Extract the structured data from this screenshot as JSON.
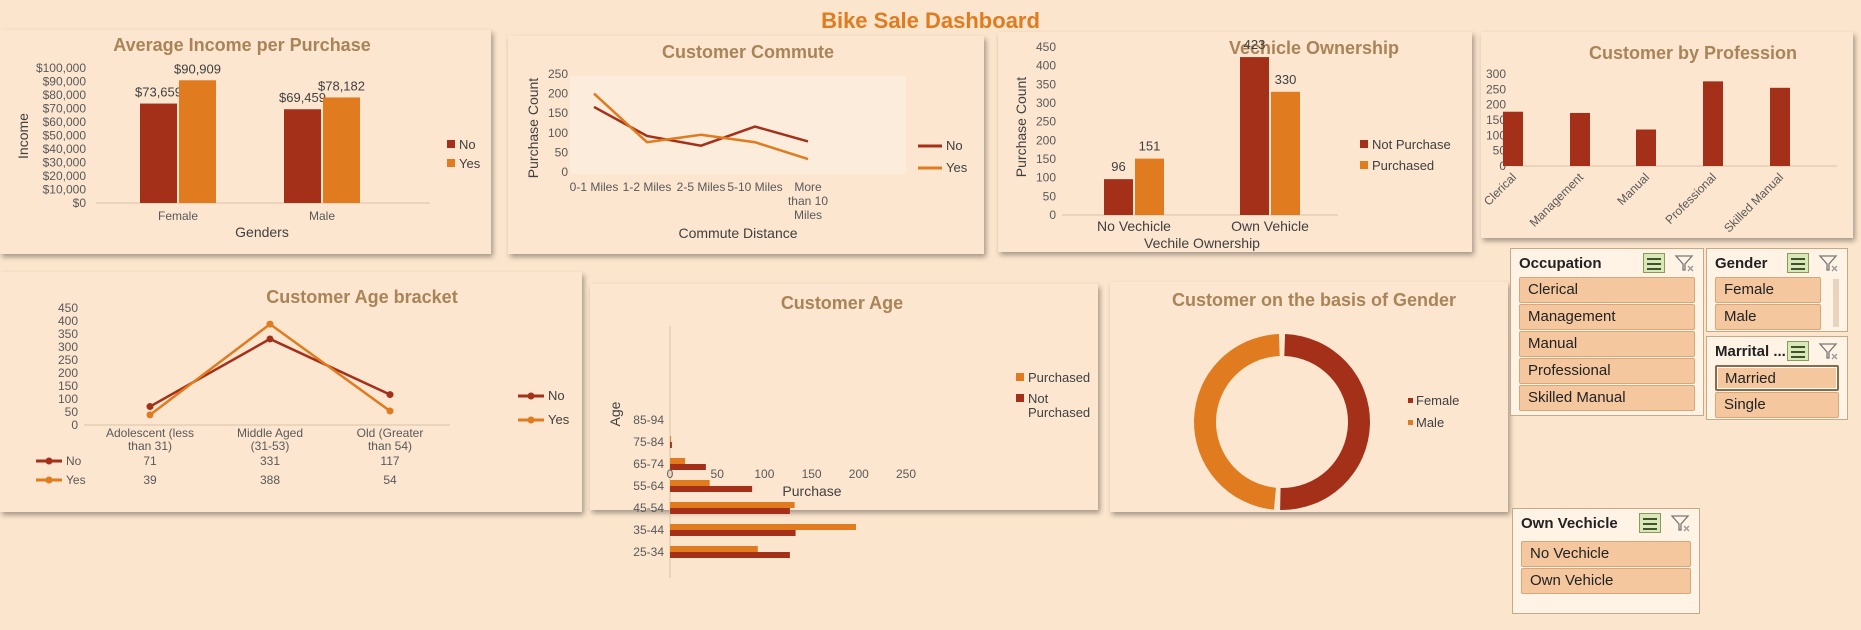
{
  "dashboard_title": "Bike Sale Dashboard",
  "colors": {
    "no": "#a4301a",
    "yes": "#e07b1f",
    "title": "#a88458",
    "bg": "#fbe5cd"
  },
  "chart_data": [
    {
      "id": "income",
      "type": "bar",
      "title": "Average Income per Purchase",
      "xlabel": "Genders",
      "ylabel": "Income",
      "categories": [
        "Female",
        "Male"
      ],
      "series": [
        {
          "name": "No",
          "values": [
            73659,
            69459
          ],
          "labels": [
            "$73,659",
            "$69,459"
          ]
        },
        {
          "name": "Yes",
          "values": [
            90909,
            78182
          ],
          "labels": [
            "$90,909",
            "$78,182"
          ]
        }
      ],
      "ylim": [
        0,
        100000
      ],
      "yticks": [
        "$0",
        "$10,000",
        "$20,000",
        "$30,000",
        "$40,000",
        "$50,000",
        "$60,000",
        "$70,000",
        "$80,000",
        "$90,000",
        "$100,000"
      ]
    },
    {
      "id": "commute",
      "type": "line",
      "title": "Customer Commute",
      "xlabel": "Commute Distance",
      "ylabel": "Purchase Count",
      "categories": [
        "0-1 Miles",
        "1-2 Miles",
        "2-5 Miles",
        "5-10 Miles",
        "More than 10 Miles"
      ],
      "category_lines": [
        [
          "0-1 Miles"
        ],
        [
          "1-2 Miles"
        ],
        [
          "2-5 Miles"
        ],
        [
          "5-10 Miles"
        ],
        [
          "More",
          "than 10",
          "Miles"
        ]
      ],
      "series": [
        {
          "name": "No",
          "values": [
            166,
            92,
            67,
            116,
            78
          ]
        },
        {
          "name": "Yes",
          "values": [
            200,
            76,
            95,
            76,
            33
          ]
        }
      ],
      "ylim": [
        0,
        250
      ],
      "yticks": [
        "0",
        "50",
        "100",
        "150",
        "200",
        "250"
      ]
    },
    {
      "id": "vehicle",
      "type": "bar",
      "title": "Vechicle Ownership",
      "xlabel": "Vechile Ownership",
      "ylabel": "Purchase Count",
      "categories": [
        "No Vechicle",
        "Own Vehicle"
      ],
      "series": [
        {
          "name": "Not Purchase",
          "values": [
            96,
            423
          ],
          "labels": [
            "96",
            "423"
          ]
        },
        {
          "name": "Purchased",
          "values": [
            151,
            330
          ],
          "labels": [
            "151",
            "330"
          ]
        }
      ],
      "ylim": [
        0,
        450
      ],
      "yticks": [
        "0",
        "50",
        "100",
        "150",
        "200",
        "250",
        "300",
        "350",
        "400",
        "450"
      ]
    },
    {
      "id": "profession",
      "type": "bar",
      "title": "Customer by Profession",
      "categories": [
        "Clerical",
        "Management",
        "Manual",
        "Professional",
        "Skilled Manual"
      ],
      "series": [
        {
          "values": [
            177,
            173,
            119,
            276,
            255
          ]
        }
      ],
      "ylim": [
        0,
        300
      ],
      "yticks": [
        "0",
        "50",
        "100",
        "150",
        "200",
        "250",
        "300"
      ]
    },
    {
      "id": "agebracket",
      "type": "line",
      "title": "Customer Age bracket",
      "categories": [
        "Adolescent (less than 31)",
        "Middle Aged (31-53)",
        "Old (Greater than 54)"
      ],
      "category_lines": [
        [
          "Adolescent (less",
          "than 31)"
        ],
        [
          "Middle Aged",
          "(31-53)"
        ],
        [
          "Old (Greater",
          "than 54)"
        ]
      ],
      "series": [
        {
          "name": "No",
          "values": [
            71,
            331,
            117
          ],
          "labels": [
            "71",
            "331",
            "117"
          ]
        },
        {
          "name": "Yes",
          "values": [
            39,
            388,
            54
          ],
          "labels": [
            "39",
            "388",
            "54"
          ]
        }
      ],
      "ylim": [
        0,
        450
      ],
      "yticks": [
        "0",
        "50",
        "100",
        "150",
        "200",
        "250",
        "300",
        "350",
        "400",
        "450"
      ]
    },
    {
      "id": "age",
      "type": "bar",
      "orientation": "horizontal",
      "title": "Customer Age",
      "xlabel": "Purchase",
      "ylabel": "Age",
      "categories": [
        "25-34",
        "35-44",
        "45-54",
        "55-64",
        "65-74",
        "75-84",
        "85-94"
      ],
      "series": [
        {
          "name": "Purchased",
          "values": [
            93,
            197,
            132,
            42,
            16,
            1,
            0
          ]
        },
        {
          "name": "Not Purchased",
          "values": [
            127,
            133,
            127,
            87,
            38,
            2,
            0
          ]
        }
      ],
      "xlim": [
        0,
        250
      ],
      "xticks": [
        "0",
        "50",
        "100",
        "150",
        "200",
        "250"
      ]
    },
    {
      "id": "gender",
      "type": "pie",
      "title": "Customer on the basis of Gender",
      "categories": [
        "Female",
        "Male"
      ],
      "values": [
        509,
        491
      ]
    }
  ],
  "slicers": {
    "occupation": {
      "title": "Occupation",
      "items": [
        "Clerical",
        "Management",
        "Manual",
        "Professional",
        "Skilled Manual"
      ]
    },
    "gender": {
      "title": "Gender",
      "items": [
        "Female",
        "Male"
      ]
    },
    "marital": {
      "title": "Marrital ...",
      "items": [
        "Married",
        "Single"
      ]
    },
    "vehicle": {
      "title": "Own Vechicle",
      "items": [
        "No Vechicle",
        "Own Vehicle"
      ]
    }
  }
}
